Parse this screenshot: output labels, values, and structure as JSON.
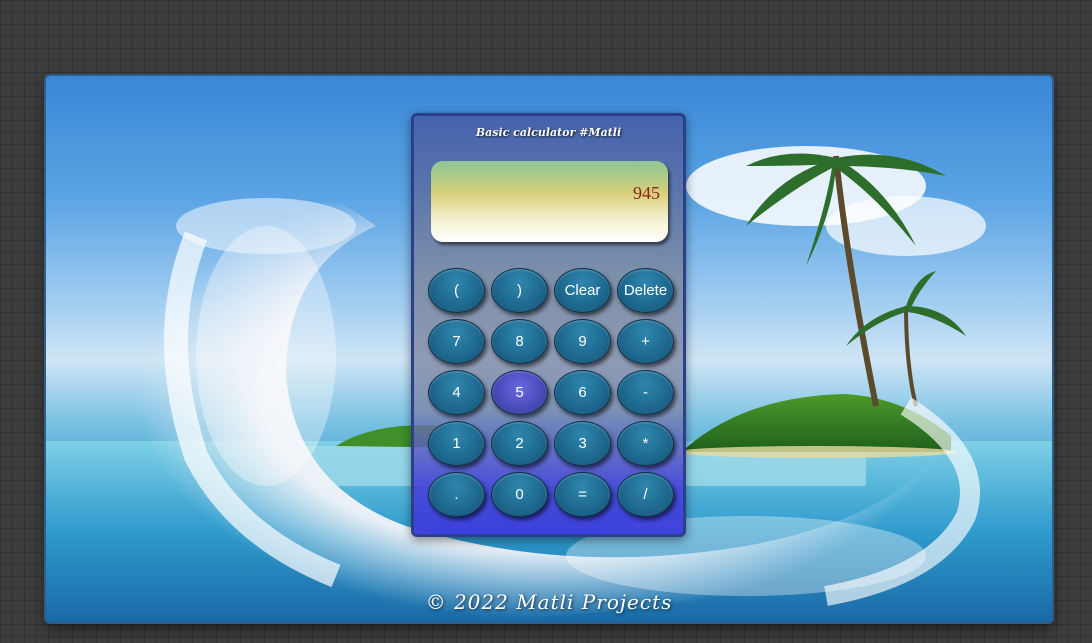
{
  "calculator": {
    "title": "Basic calculator #Matli",
    "display_value": "945",
    "keys": [
      {
        "label": "(",
        "name": "open-paren"
      },
      {
        "label": ")",
        "name": "close-paren"
      },
      {
        "label": "Clear",
        "name": "clear"
      },
      {
        "label": "Delete",
        "name": "delete"
      },
      {
        "label": "7",
        "name": "7"
      },
      {
        "label": "8",
        "name": "8"
      },
      {
        "label": "9",
        "name": "9"
      },
      {
        "label": "+",
        "name": "plus"
      },
      {
        "label": "4",
        "name": "4"
      },
      {
        "label": "5",
        "name": "5"
      },
      {
        "label": "6",
        "name": "6"
      },
      {
        "label": "-",
        "name": "minus"
      },
      {
        "label": "1",
        "name": "1"
      },
      {
        "label": "2",
        "name": "2"
      },
      {
        "label": "3",
        "name": "3"
      },
      {
        "label": "*",
        "name": "multiply"
      },
      {
        "label": ".",
        "name": "decimal"
      },
      {
        "label": "0",
        "name": "0"
      },
      {
        "label": "=",
        "name": "equals"
      },
      {
        "label": "/",
        "name": "divide"
      }
    ],
    "hovered_key": "5"
  },
  "footer": {
    "text": "© 2022 Matli Projects"
  },
  "colors": {
    "page_background": "#3d3d3d",
    "key_fill": "#1f6a91",
    "key_hover_fill": "#4b4bbd",
    "display_text": "#8a1f1f",
    "calculator_border": "#2b3f8a"
  }
}
